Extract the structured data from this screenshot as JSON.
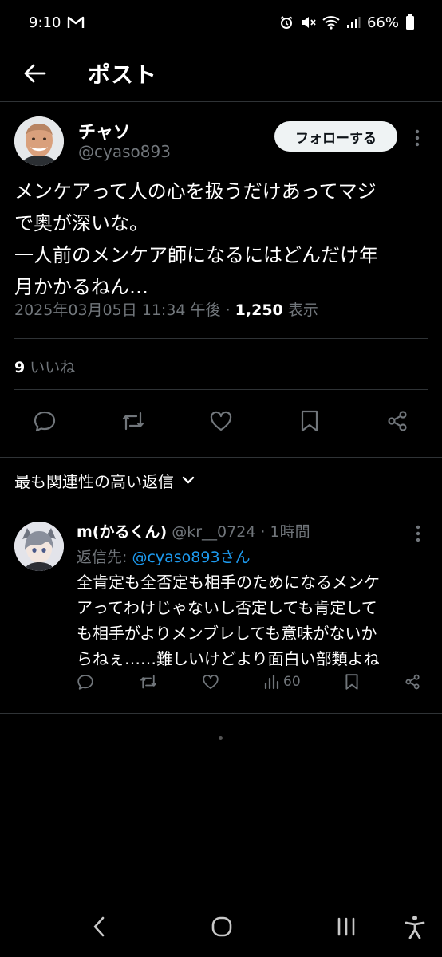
{
  "status_bar": {
    "time": "9:10",
    "battery": "66%"
  },
  "header": {
    "title": "ポスト"
  },
  "post": {
    "author_name": "チャソ",
    "author_handle": "@cyaso893",
    "follow_label": "フォローする",
    "text": "メンケアって人の心を扱うだけあってマジ\nで奥が深いな。\n一人前のメンケア師になるにはどんだけ年\n月かかるねん…",
    "timestamp": "2025年03月05日 11:34 午後",
    "separator": " · ",
    "views_count": "1,250",
    "views_label": "表示",
    "likes_count": "9",
    "likes_label": "いいね"
  },
  "replies_sort": {
    "label": "最も関連性の高い返信"
  },
  "reply": {
    "name": "m(かるくん)",
    "handle": "@kr__0724",
    "dot": " · ",
    "time": "1時間",
    "reply_to_label": "返信先: ",
    "reply_to_mention": "@cyaso893さん",
    "text": "全肯定も全否定も相手のためになるメンケ\nアってわけじゃないし否定しても肯定して\nも相手がよりメンブレしても意味がないか\nらねぇ……難しいけどより面白い部類よね",
    "views": "60"
  },
  "icons": {
    "back": "arrow-left-icon",
    "more": "more-vertical-icon",
    "reply": "chat-bubble-icon",
    "retweet": "repost-icon",
    "like": "heart-icon",
    "bookmark": "bookmark-icon",
    "share": "share-icon",
    "views": "bar-chart-icon"
  },
  "colors": {
    "background": "#000000",
    "text": "#e7e9ea",
    "muted": "#71767b",
    "accent": "#1d9bf0",
    "divider": "#2f3336"
  }
}
